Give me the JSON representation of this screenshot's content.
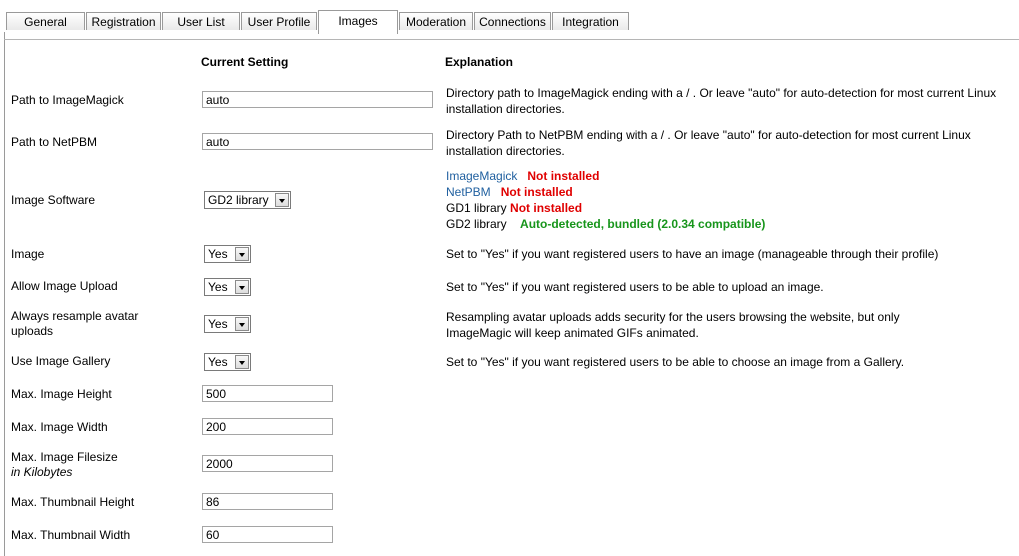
{
  "tabs": [
    {
      "label": "General"
    },
    {
      "label": "Registration"
    },
    {
      "label": "User List"
    },
    {
      "label": "User Profile"
    },
    {
      "label": "Images",
      "active": true
    },
    {
      "label": "Moderation"
    },
    {
      "label": "Connections"
    },
    {
      "label": "Integration"
    }
  ],
  "headers": {
    "current": "Current Setting",
    "explanation": "Explanation"
  },
  "rows": {
    "imagemagick_path": {
      "label": "Path to ImageMagick",
      "value": "auto",
      "explanation": "Directory path to ImageMagick ending with a / . Or leave \"auto\" for auto-detection for most current Linux installation directories."
    },
    "netpbm_path": {
      "label": "Path to NetPBM",
      "value": "auto",
      "explanation": "Directory Path to NetPBM ending with a / . Or leave \"auto\" for auto-detection for most current Linux installation directories."
    },
    "image_software": {
      "label": "Image Software",
      "value": "GD2 library",
      "status": [
        {
          "name": "ImageMagick",
          "state": "Not installed"
        },
        {
          "name": "NetPBM",
          "state": "Not installed"
        },
        {
          "name": "GD1 library",
          "state": "Not installed"
        },
        {
          "name": "GD2 library",
          "state": "Auto-detected, bundled (2.0.34 compatible)"
        }
      ]
    },
    "image": {
      "label": "Image",
      "value": "Yes",
      "explanation": "Set to \"Yes\" if you want registered users to have an image (manageable through their profile)"
    },
    "allow_upload": {
      "label": "Allow Image Upload",
      "value": "Yes",
      "explanation": "Set to \"Yes\" if you want registered users to be able to upload an image."
    },
    "resample": {
      "label_line1": "Always resample avatar",
      "label_line2": "uploads",
      "value": "Yes",
      "explanation": "Resampling avatar uploads adds security for the users browsing the website, but only ImageMagic will keep animated GIFs animated."
    },
    "gallery": {
      "label": "Use Image Gallery",
      "value": "Yes",
      "explanation": "Set to \"Yes\" if you want registered users to be able to choose an image from a Gallery."
    },
    "max_height": {
      "label": "Max. Image Height",
      "value": "500"
    },
    "max_width": {
      "label": "Max. Image Width",
      "value": "200"
    },
    "max_filesize": {
      "label_line1": "Max. Image Filesize",
      "label_line2": "in Kilobytes",
      "value": "2000"
    },
    "thumb_height": {
      "label": "Max. Thumbnail Height",
      "value": "86"
    },
    "thumb_width": {
      "label": "Max. Thumbnail Width",
      "value": "60"
    }
  },
  "colors": {
    "link": "#1f5f9f",
    "error": "#e00000",
    "ok": "#17951b"
  }
}
